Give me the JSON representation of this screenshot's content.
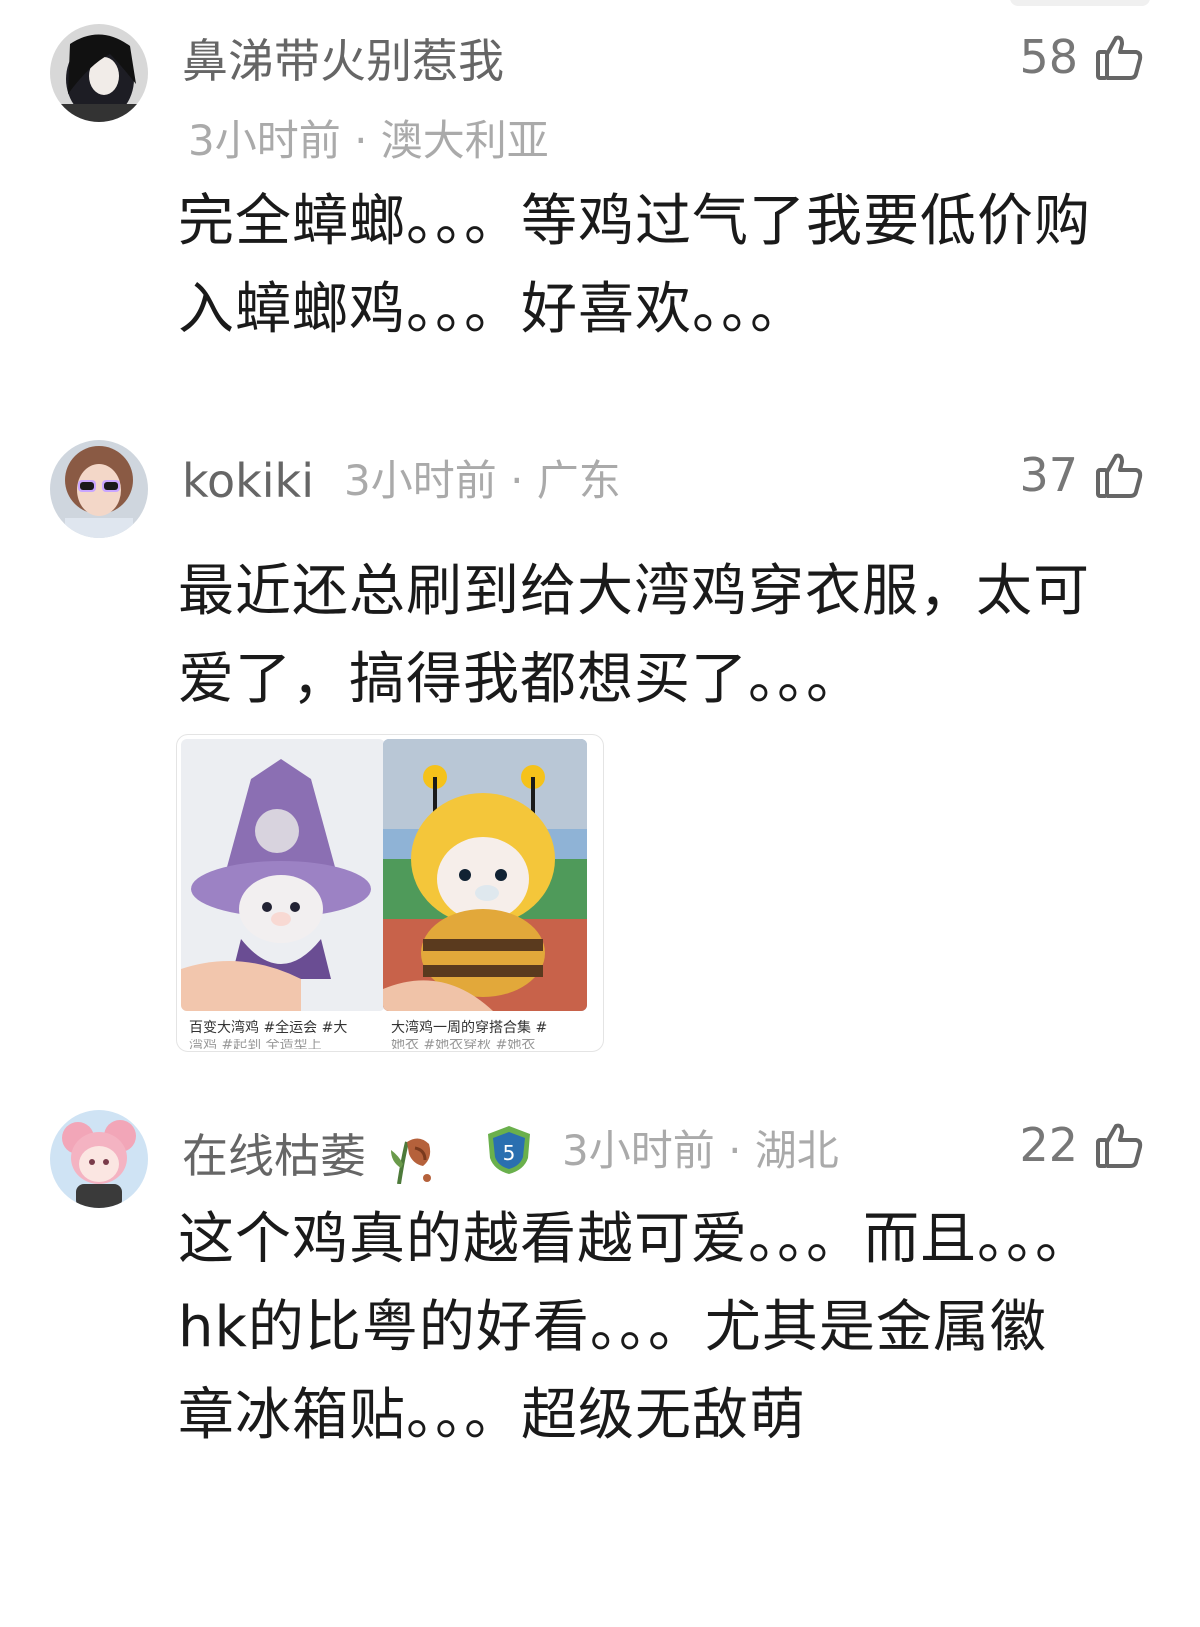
{
  "comments": [
    {
      "username": "鼻涕带火别惹我",
      "meta": "3小时前 · 澳大利亚",
      "likes": "58",
      "text": "完全蟑螂。。。等鸡过气了我要低价购入蟑螂鸡。。。好喜欢。。。",
      "avatar_icon": "avatar-dark-hair"
    },
    {
      "username": "kokiki",
      "meta": "3小时前 · 广东",
      "likes": "37",
      "text": "最近还总刷到给大湾鸡穿衣服，太可爱了，搞得我都想买了。。。",
      "avatar_icon": "avatar-child-sunglasses",
      "attachments": [
        {
          "caption": "百变大湾鸡 #全运会 #大",
          "caption_line2": "湾鸡 #起到 全造型上",
          "icon": "purple-witch-plush"
        },
        {
          "caption": "大湾鸡一周的穿搭合集 #",
          "caption_line2": "她衣 #她衣穿秋 #她衣",
          "icon": "bee-costume-plush"
        }
      ]
    },
    {
      "username": "在线枯萎",
      "meta": "3小时前 · 湖北",
      "likes": "22",
      "badge_number": "5",
      "text": "这个鸡真的越看越可爱。。。而且。。。hk的比粤的好看。。。尤其是金属徽章冰箱贴。。。超级无敌萌",
      "avatar_icon": "avatar-pink-anime"
    }
  ],
  "colors": {
    "meta": "#aaaaaa",
    "username": "#666666",
    "text": "#1a1a1a",
    "badge": "#2a6fb0"
  }
}
